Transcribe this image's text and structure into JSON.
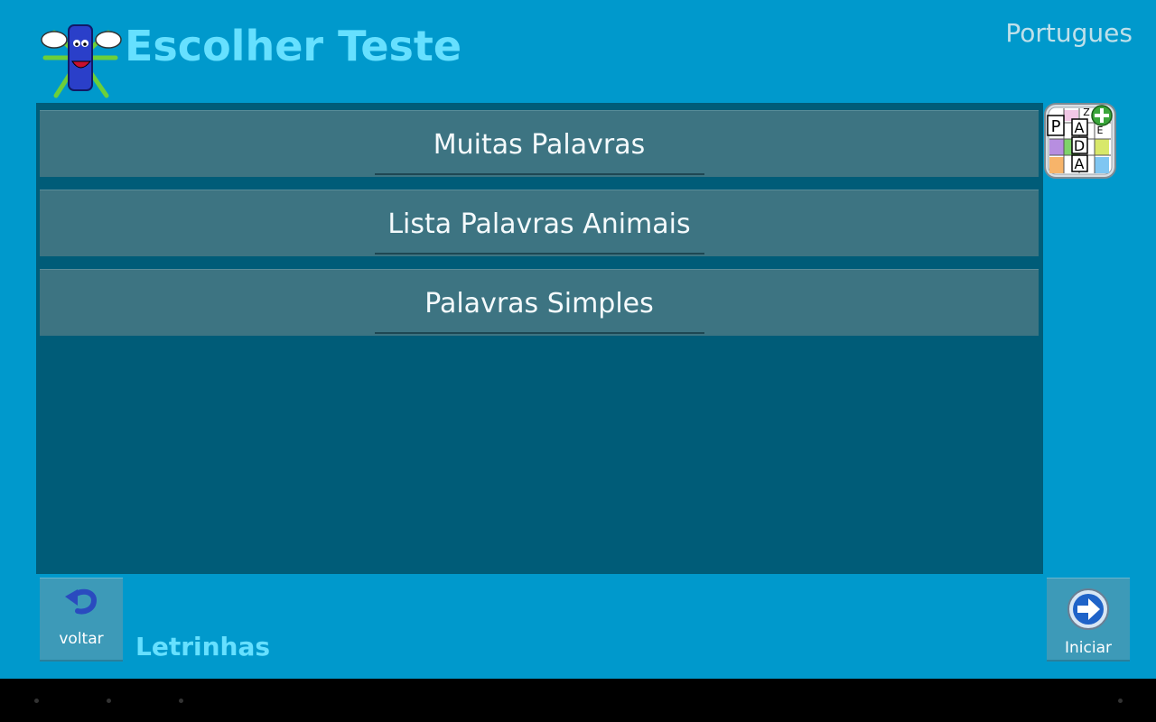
{
  "header": {
    "title": "Escolher Teste",
    "language": "Portugues"
  },
  "tests": [
    {
      "label": "Muitas Palavras"
    },
    {
      "label": "Lista Palavras Animais"
    },
    {
      "label": "Palavras Simples"
    }
  ],
  "puzzle_icon": {
    "letters": [
      "P",
      "A",
      "D",
      "A",
      "Z",
      "E"
    ]
  },
  "footer": {
    "back_label": "voltar",
    "app_name": "Letrinhas",
    "start_label": "Iniciar"
  },
  "colors": {
    "background": "#0099cc",
    "panel": "#005c78",
    "item": "#3d7482",
    "accent_text": "#66e0ff",
    "tile": "#3d9ab8"
  },
  "icons": {
    "back": "undo-arrow-icon",
    "start": "arrow-right-circle-icon",
    "logo": "mascot-logo-icon",
    "puzzle": "word-puzzle-icon"
  }
}
